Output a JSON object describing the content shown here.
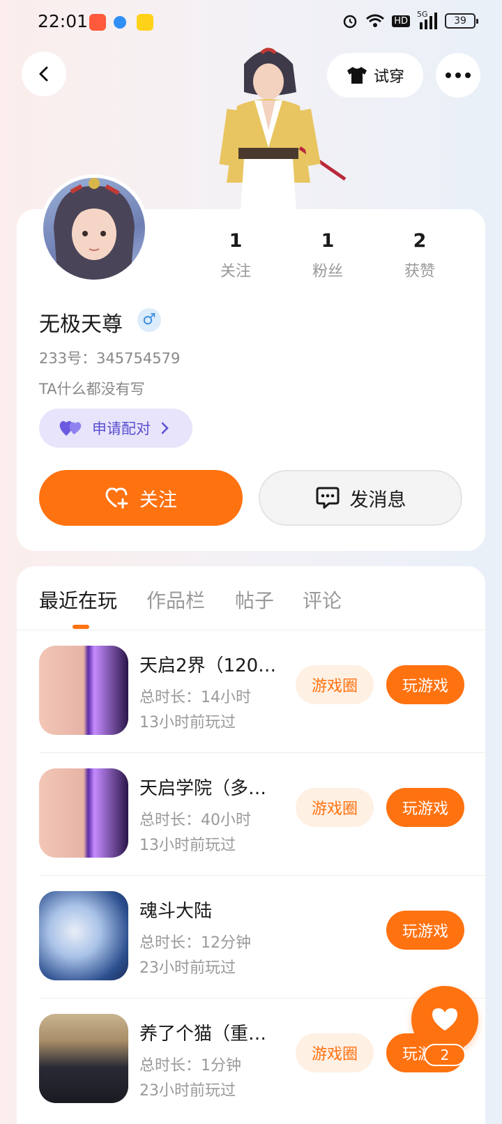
{
  "status_bar": {
    "time": "22:01",
    "network": "5G",
    "hd": "HD",
    "battery": "39"
  },
  "header": {
    "tryon_label": "试穿"
  },
  "profile": {
    "name": "无极天尊",
    "gender_symbol": "♂",
    "id_text": "233号：345754579",
    "bio": "TA什么都没有写",
    "pair_label": "申请配对",
    "follow_label": "关注",
    "message_label": "发消息",
    "stats": [
      {
        "value": "1",
        "label": "关注"
      },
      {
        "value": "1",
        "label": "粉丝"
      },
      {
        "value": "2",
        "label": "获赞"
      }
    ]
  },
  "tabs": [
    {
      "label": "最近在玩"
    },
    {
      "label": "作品栏"
    },
    {
      "label": "帖子"
    },
    {
      "label": "评论"
    }
  ],
  "games": [
    {
      "title": "天启2界（120…",
      "duration": "总时长：14小时",
      "last_played": "13小时前玩过",
      "circle_label": "游戏圈",
      "play_label": "玩游戏"
    },
    {
      "title": "天启学院（多…",
      "duration": "总时长：40小时",
      "last_played": "13小时前玩过",
      "circle_label": "游戏圈",
      "play_label": "玩游戏"
    },
    {
      "title": "魂斗大陆",
      "duration": "总时长：12分钟",
      "last_played": "23小时前玩过",
      "play_label": "玩游戏"
    },
    {
      "title": "养了个猫（重…",
      "duration": "总时长：1分钟",
      "last_played": "23小时前玩过",
      "circle_label": "游戏圈",
      "play_label": "玩游戏"
    }
  ],
  "floating": {
    "like_count": "2"
  },
  "colors": {
    "accent": "#ff7210",
    "pair_bg": "#e7e4fb",
    "pair_text": "#5a4fcf"
  }
}
